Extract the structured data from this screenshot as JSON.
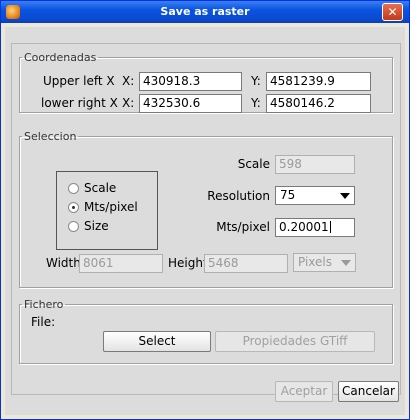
{
  "window": {
    "title": "Save as raster",
    "close_glyph": "✕"
  },
  "coordenadas": {
    "legend": "Coordenadas",
    "upper_left_label": "Upper left X",
    "lower_right_label": "lower right X",
    "x_label": "X:",
    "y_label": "Y:",
    "upper_left_x": "430918.3",
    "upper_left_y": "4581239.9",
    "lower_right_x": "432530.6",
    "lower_right_y": "4580146.2"
  },
  "seleccion": {
    "legend": "Seleccion",
    "options": [
      {
        "label": "Scale",
        "selected": false
      },
      {
        "label": "Mts/pixel",
        "selected": true
      },
      {
        "label": "Size",
        "selected": false
      }
    ],
    "scale_label": "Scale",
    "scale_value": "598",
    "resolution_label": "Resolution",
    "resolution_value": "75",
    "mts_pixel_label": "Mts/pixel",
    "mts_pixel_value": "0.20001",
    "width_label": "Width",
    "width_value": "8061",
    "height_label": "Height",
    "height_value": "5468",
    "units_value": "Pixels"
  },
  "fichero": {
    "legend": "Fichero",
    "file_label": "File:",
    "select_button": "Select",
    "properties_button": "Propiedades GTiff"
  },
  "footer": {
    "accept_button": "Aceptar",
    "cancel_button": "Cancelar"
  }
}
